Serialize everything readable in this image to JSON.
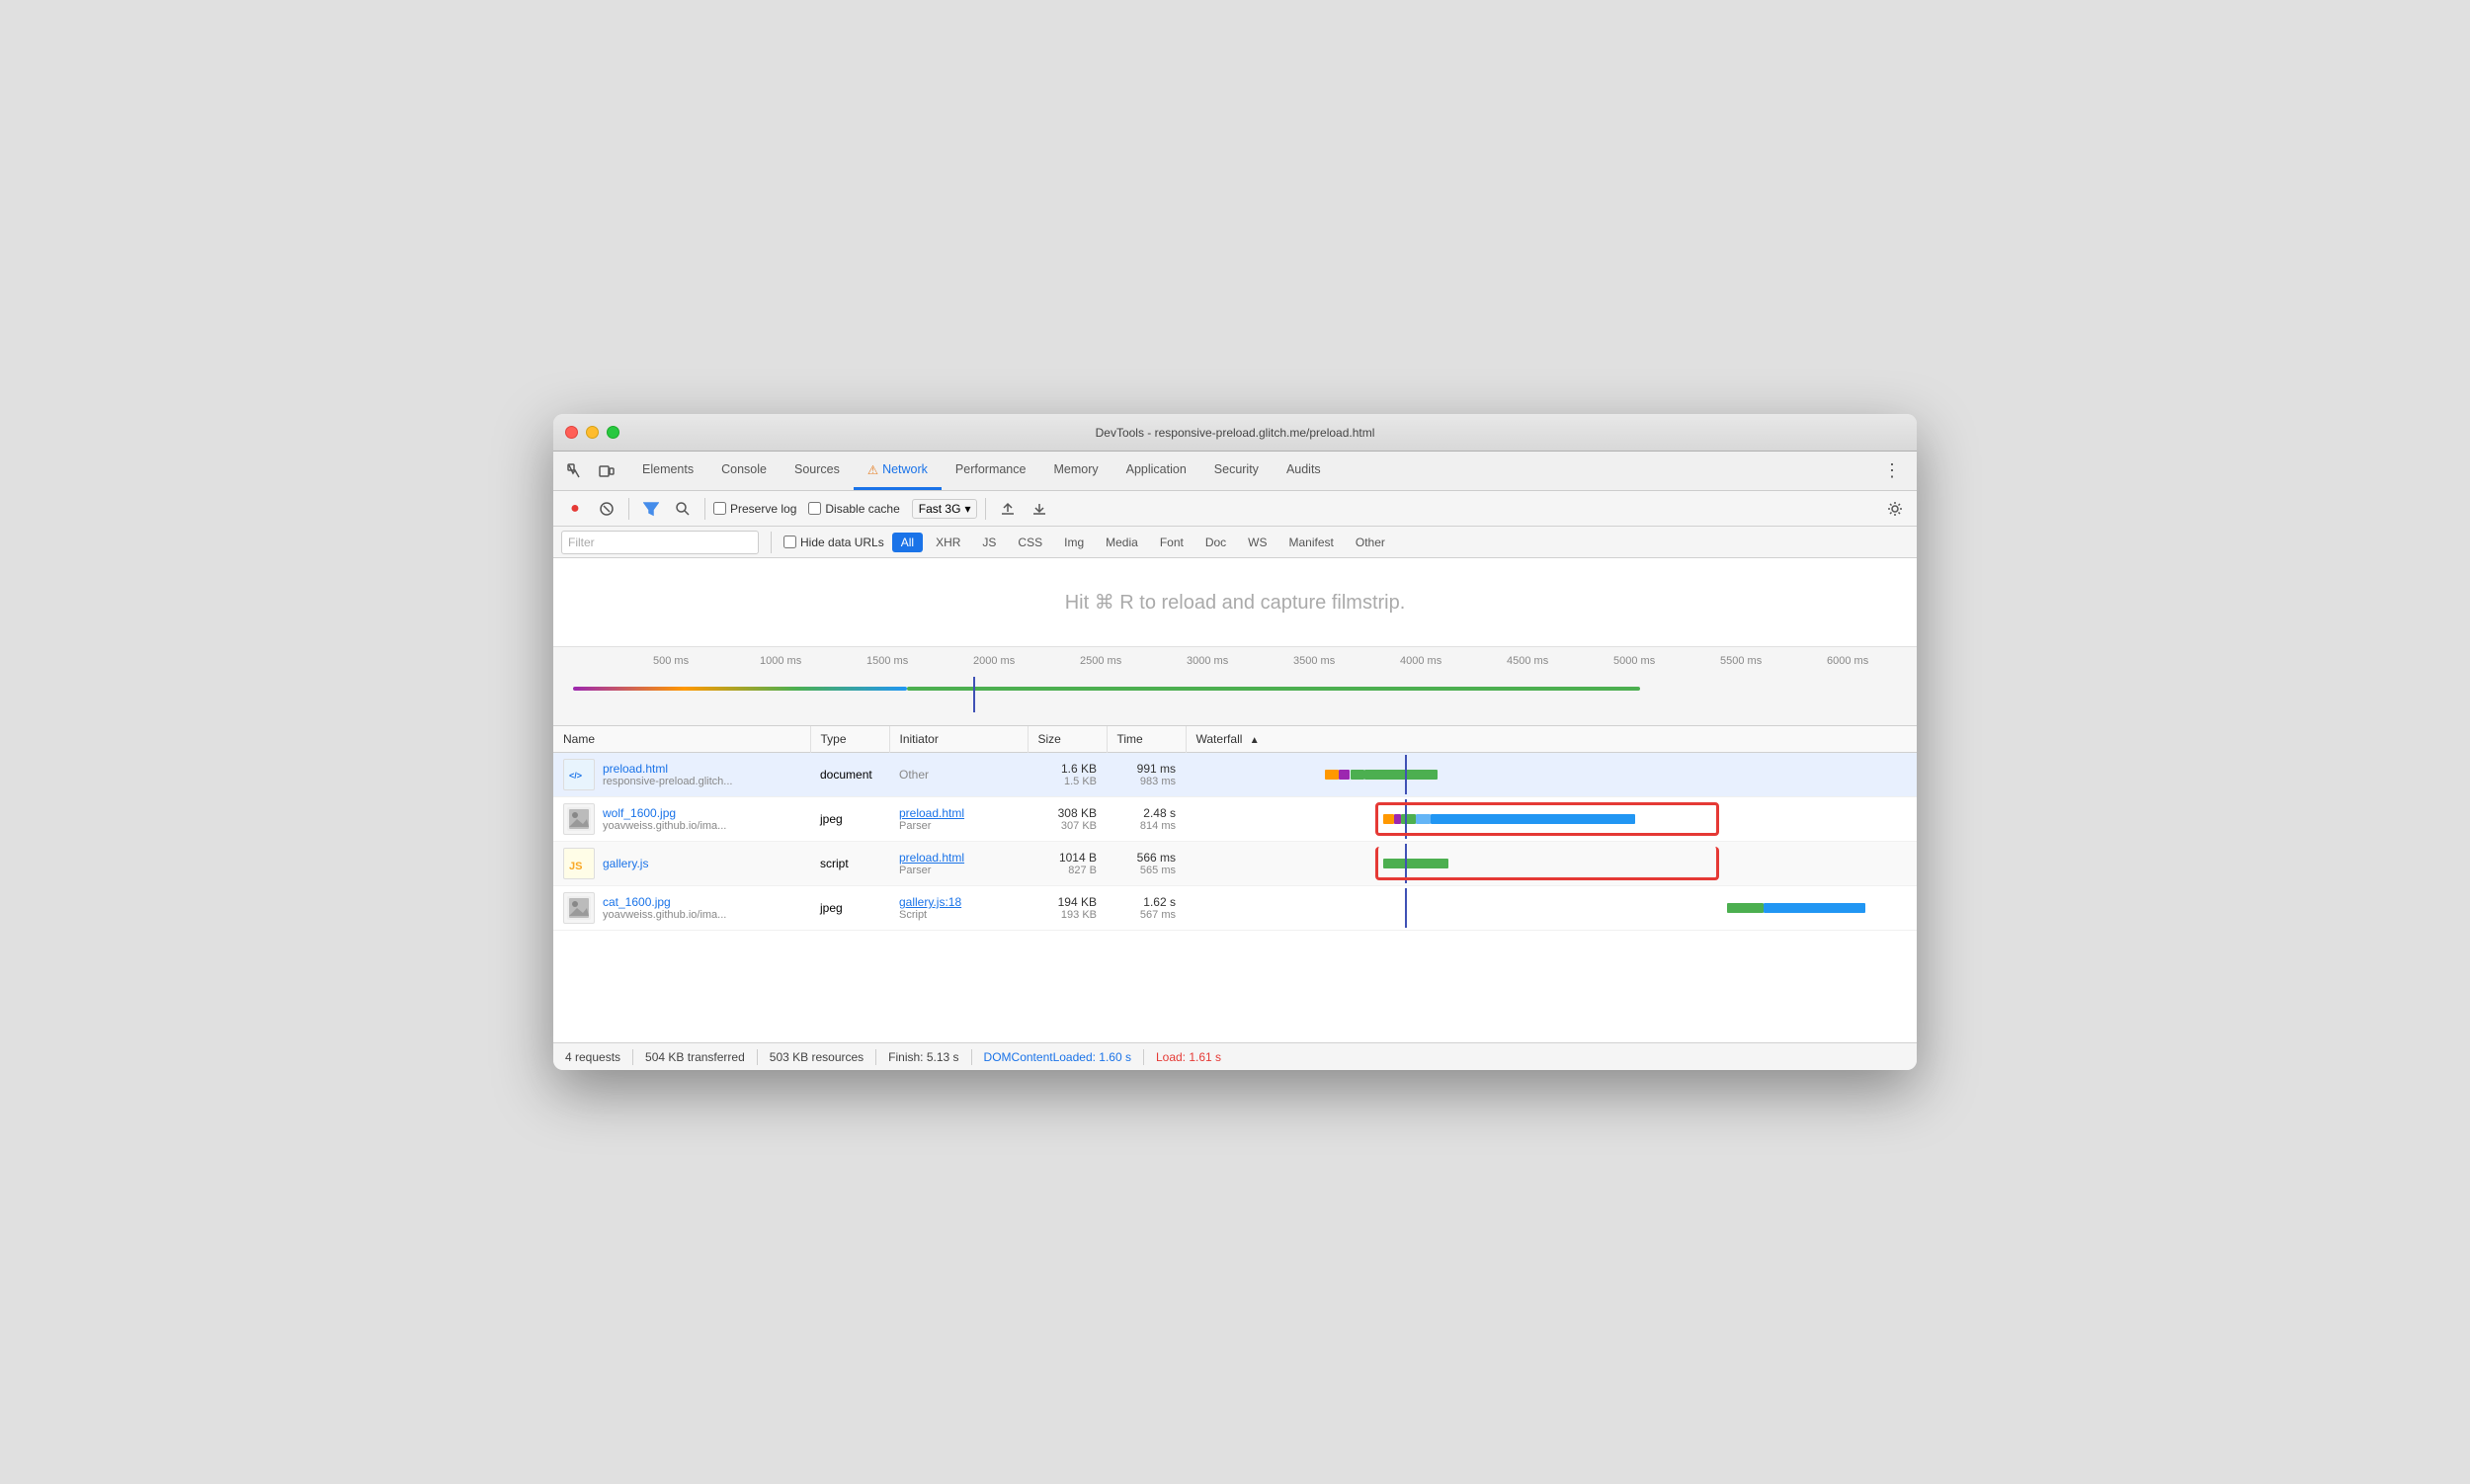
{
  "window": {
    "title": "DevTools - responsive-preload.glitch.me/preload.html"
  },
  "tabs": {
    "items": [
      {
        "label": "Elements",
        "active": false,
        "warning": false
      },
      {
        "label": "Console",
        "active": false,
        "warning": false
      },
      {
        "label": "Sources",
        "active": false,
        "warning": false
      },
      {
        "label": "⚠ Network",
        "active": true,
        "warning": true
      },
      {
        "label": "Performance",
        "active": false,
        "warning": false
      },
      {
        "label": "Memory",
        "active": false,
        "warning": false
      },
      {
        "label": "Application",
        "active": false,
        "warning": false
      },
      {
        "label": "Security",
        "active": false,
        "warning": false
      },
      {
        "label": "Audits",
        "active": false,
        "warning": false
      }
    ],
    "more_label": "⋮"
  },
  "toolbar": {
    "record_tooltip": "Record",
    "clear_tooltip": "Clear",
    "filter_tooltip": "Filter",
    "search_tooltip": "Search",
    "preserve_log_label": "Preserve log",
    "disable_cache_label": "Disable cache",
    "throttle_label": "Fast 3G",
    "upload_tooltip": "Import HAR file",
    "download_tooltip": "Export HAR file",
    "settings_tooltip": "Settings"
  },
  "filter_bar": {
    "filter_placeholder": "Filter",
    "hide_data_urls_label": "Hide data URLs",
    "types": [
      {
        "label": "All",
        "active": true
      },
      {
        "label": "XHR",
        "active": false
      },
      {
        "label": "JS",
        "active": false
      },
      {
        "label": "CSS",
        "active": false
      },
      {
        "label": "Img",
        "active": false
      },
      {
        "label": "Media",
        "active": false
      },
      {
        "label": "Font",
        "active": false
      },
      {
        "label": "Doc",
        "active": false
      },
      {
        "label": "WS",
        "active": false
      },
      {
        "label": "Manifest",
        "active": false
      },
      {
        "label": "Other",
        "active": false
      }
    ]
  },
  "filmstrip": {
    "hint": "Hit ⌘ R to reload and capture filmstrip."
  },
  "timeline": {
    "marks": [
      {
        "label": "500 ms",
        "pos_pct": 6
      },
      {
        "label": "1000 ms",
        "pos_pct": 14
      },
      {
        "label": "1500 ms",
        "pos_pct": 22
      },
      {
        "label": "2000 ms",
        "pos_pct": 30
      },
      {
        "label": "2500 ms",
        "pos_pct": 38
      },
      {
        "label": "3000 ms",
        "pos_pct": 46
      },
      {
        "label": "3500 ms",
        "pos_pct": 54
      },
      {
        "label": "4000 ms",
        "pos_pct": 62
      },
      {
        "label": "4500 ms",
        "pos_pct": 70
      },
      {
        "label": "5000 ms",
        "pos_pct": 78
      },
      {
        "label": "5500 ms",
        "pos_pct": 86
      },
      {
        "label": "6000 ms",
        "pos_pct": 94
      }
    ]
  },
  "table": {
    "headers": [
      {
        "label": "Name",
        "sortable": false
      },
      {
        "label": "Type",
        "sortable": false
      },
      {
        "label": "Initiator",
        "sortable": false
      },
      {
        "label": "Size",
        "sortable": false
      },
      {
        "label": "Time",
        "sortable": false
      },
      {
        "label": "Waterfall",
        "sortable": true,
        "sort_dir": "asc"
      }
    ],
    "rows": [
      {
        "id": "row1",
        "selected": true,
        "icon_type": "html",
        "name": "preload.html",
        "url": "responsive-preload.glitch...",
        "type": "document",
        "initiator_label": "Other",
        "initiator_link": null,
        "size_transfer": "1.6 KB",
        "size_resource": "1.5 KB",
        "time_main": "991 ms",
        "time_sub": "983 ms",
        "waterfall_bars": [
          {
            "type": "dns",
            "left_pct": 19,
            "width_pct": 1.5
          },
          {
            "type": "connect",
            "left_pct": 20.5,
            "width_pct": 1.5
          },
          {
            "type": "ttfb",
            "left_pct": 22,
            "width_pct": 2
          },
          {
            "type": "download",
            "left_pct": 24,
            "width_pct": 8
          }
        ]
      },
      {
        "id": "row2",
        "selected": false,
        "icon_type": "img",
        "name": "wolf_1600.jpg",
        "url": "yoavweiss.github.io/ima...",
        "type": "jpeg",
        "initiator_label": "preload.html",
        "initiator_link": "preload.html",
        "initiator_sub": "Parser",
        "size_transfer": "308 KB",
        "size_resource": "307 KB",
        "time_main": "2.48 s",
        "time_sub": "814 ms",
        "waterfall_bars": [
          {
            "type": "dns",
            "left_pct": 27,
            "width_pct": 1
          },
          {
            "type": "connect",
            "left_pct": 28,
            "width_pct": 1
          },
          {
            "type": "ttfb",
            "left_pct": 29,
            "width_pct": 1
          },
          {
            "type": "waiting",
            "left_pct": 30,
            "width_pct": 2
          },
          {
            "type": "download",
            "left_pct": 32,
            "width_pct": 28
          }
        ]
      },
      {
        "id": "row3",
        "selected": false,
        "icon_type": "js",
        "name": "gallery.js",
        "url": "",
        "type": "script",
        "initiator_label": "preload.html",
        "initiator_link": "preload.html",
        "initiator_sub": "Parser",
        "size_transfer": "1014 B",
        "size_resource": "827 B",
        "time_main": "566 ms",
        "time_sub": "565 ms",
        "waterfall_bars": [
          {
            "type": "download",
            "left_pct": 27,
            "width_pct": 8
          }
        ]
      },
      {
        "id": "row4",
        "selected": false,
        "icon_type": "img",
        "name": "cat_1600.jpg",
        "url": "yoavweiss.github.io/ima...",
        "type": "jpeg",
        "initiator_label": "gallery.js:18",
        "initiator_link": "gallery.js:18",
        "initiator_sub": "Script",
        "size_transfer": "194 KB",
        "size_resource": "193 KB",
        "time_main": "1.62 s",
        "time_sub": "567 ms",
        "waterfall_bars": [
          {
            "type": "download",
            "left_pct": 74,
            "width_pct": 4
          },
          {
            "type": "waiting",
            "left_pct": 78,
            "width_pct": 12
          }
        ]
      }
    ]
  },
  "status_bar": {
    "requests": "4 requests",
    "transferred": "504 KB transferred",
    "resources": "503 KB resources",
    "finish": "Finish: 5.13 s",
    "dom_loaded": "DOMContentLoaded: 1.60 s",
    "load": "Load: 1.61 s"
  }
}
